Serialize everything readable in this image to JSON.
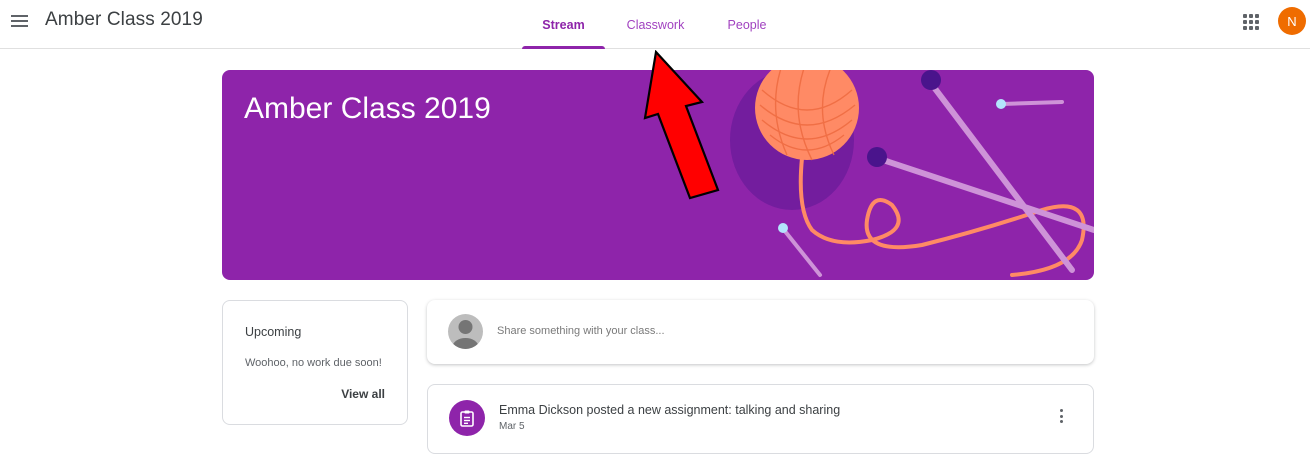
{
  "header": {
    "app_title": "Amber Class 2019",
    "tabs": [
      {
        "label": "Stream",
        "active": true
      },
      {
        "label": "Classwork",
        "active": false
      },
      {
        "label": "People",
        "active": false
      }
    ],
    "avatar_initial": "N",
    "avatar_color": "#ef6c00",
    "accent_color": "#8e24aa"
  },
  "banner": {
    "title": "Amber Class 2019",
    "background_color": "#8e24aa"
  },
  "upcoming": {
    "title": "Upcoming",
    "message": "Woohoo, no work due soon!",
    "view_all_label": "View all"
  },
  "share": {
    "placeholder": "Share something with your class..."
  },
  "posts": [
    {
      "title": "Emma Dickson posted a new assignment: talking and sharing",
      "date": "Mar 5",
      "icon": "assignment-icon"
    }
  ],
  "annotation": {
    "icon": "red-arrow-icon",
    "color": "#ff0000"
  }
}
